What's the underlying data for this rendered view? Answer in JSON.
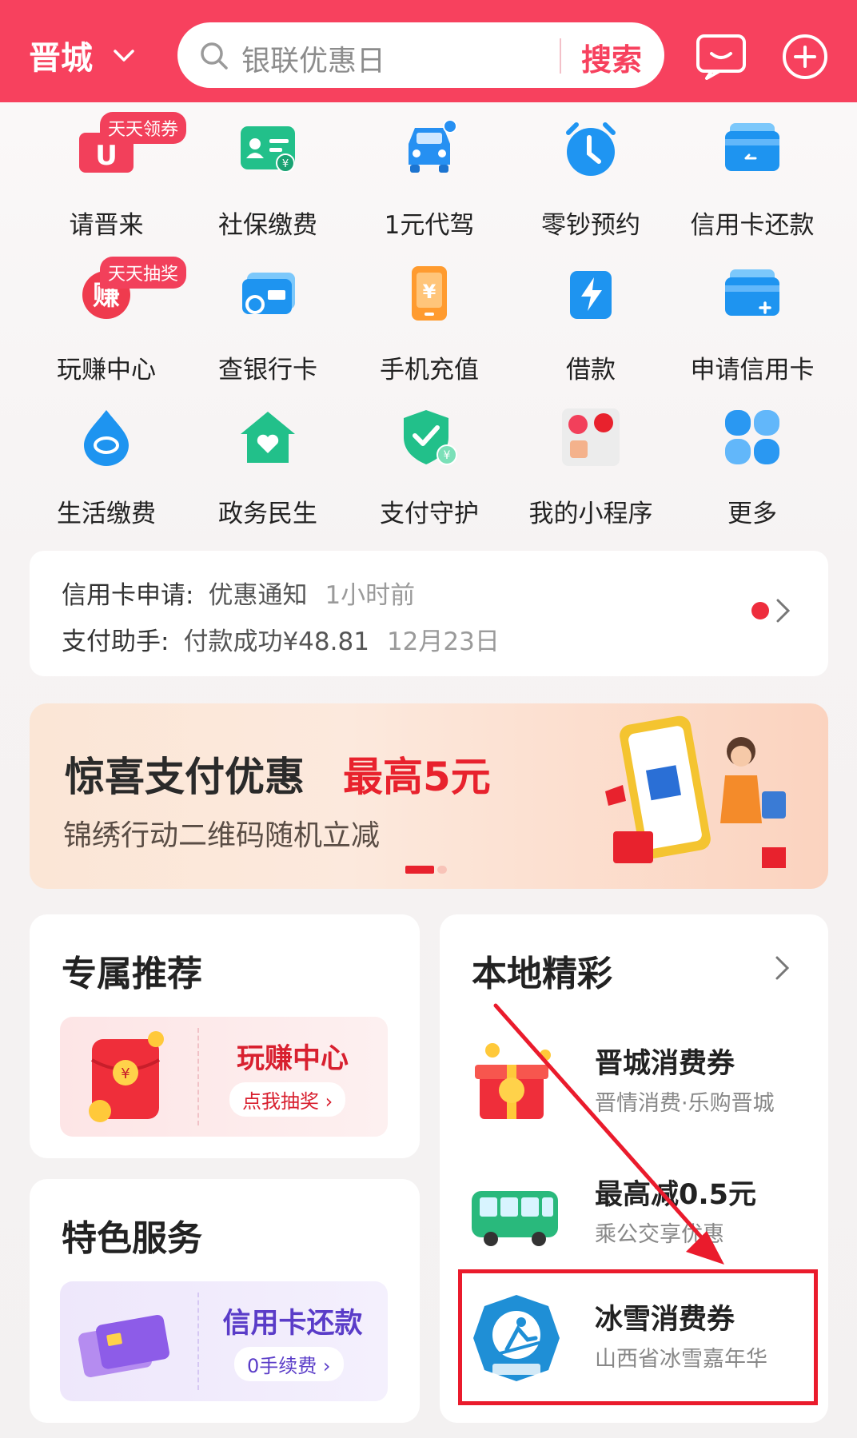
{
  "header": {
    "city": "晋城",
    "search_placeholder": "银联优惠日",
    "search_button": "搜索",
    "bg_color": "#f7415e"
  },
  "grid": [
    {
      "label": "请晋来",
      "icon": "u-coupon-icon",
      "badge": "天天领券"
    },
    {
      "label": "社保缴费",
      "icon": "social-security-card-icon"
    },
    {
      "label": "1元代驾",
      "icon": "car-icon"
    },
    {
      "label": "零钞预约",
      "icon": "alarm-clock-icon"
    },
    {
      "label": "信用卡还款",
      "icon": "credit-card-repay-icon"
    },
    {
      "label": "玩赚中心",
      "icon": "earn-icon",
      "badge": "天天抽奖"
    },
    {
      "label": "查银行卡",
      "icon": "bank-card-search-icon"
    },
    {
      "label": "手机充值",
      "icon": "phone-recharge-icon"
    },
    {
      "label": "借款",
      "icon": "loan-bolt-icon"
    },
    {
      "label": "申请信用卡",
      "icon": "apply-card-icon"
    },
    {
      "label": "生活缴费",
      "icon": "water-drop-icon"
    },
    {
      "label": "政务民生",
      "icon": "house-heart-icon"
    },
    {
      "label": "支付守护",
      "icon": "shield-check-icon"
    },
    {
      "label": "我的小程序",
      "icon": "mini-programs-icon"
    },
    {
      "label": "更多",
      "icon": "four-petal-icon"
    }
  ],
  "notice": {
    "row1": {
      "key": "信用卡申请:",
      "value": "优惠通知",
      "time": "1小时前"
    },
    "row2": {
      "key": "支付助手:",
      "value": "付款成功¥48.81",
      "time": "12月23日"
    }
  },
  "banner": {
    "title": "惊喜支付优惠",
    "highlight": "最高5元",
    "subtitle": "锦绣行动二维码随机立减"
  },
  "recommend": {
    "title": "专属推荐",
    "coupon_name": "玩赚中心",
    "coupon_action": "点我抽奖 ›"
  },
  "special": {
    "title": "特色服务",
    "coupon_name": "信用卡还款",
    "coupon_action": "0手续费 ›"
  },
  "local": {
    "title": "本地精彩",
    "items": [
      {
        "name": "晋城消费券",
        "desc": "晋情消费·乐购晋城"
      },
      {
        "name": "最高减0.5元",
        "desc": "乘公交享优惠"
      },
      {
        "name": "冰雪消费券",
        "desc": "山西省冰雪嘉年华"
      }
    ]
  }
}
